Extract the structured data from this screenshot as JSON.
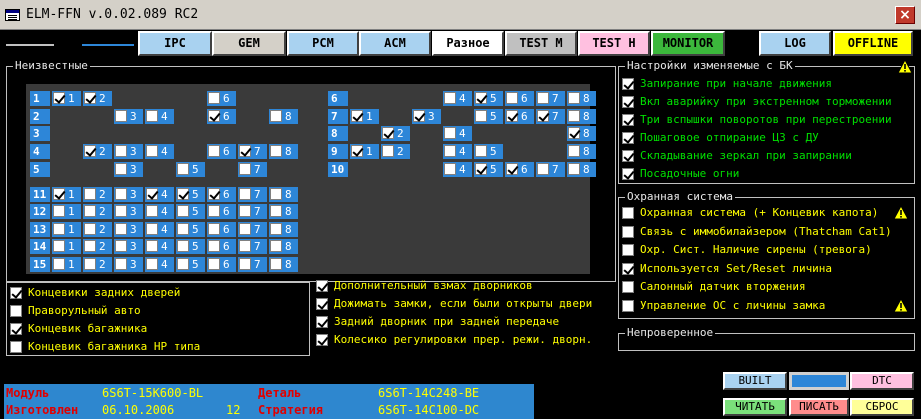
{
  "window": {
    "title": "ELM-FFN    v.0.02.089 RC2",
    "close": "×"
  },
  "status_lamps": {
    "left_color": "#c0c0c0",
    "right_color": "#2d86d8"
  },
  "tabs": [
    {
      "label": "IPC",
      "bg": "#a9d2f0"
    },
    {
      "label": "GEM",
      "bg": "#d4d0c8"
    },
    {
      "label": "PCM",
      "bg": "#a9d2f0"
    },
    {
      "label": "ACM",
      "bg": "#a9d2f0"
    },
    {
      "label": "Разное",
      "bg": "#ffffff"
    },
    {
      "label": "TEST M",
      "bg": "#c0c0c0"
    },
    {
      "label": "TEST H",
      "bg": "#ffc0e0"
    },
    {
      "label": "MONITOR",
      "bg": "#3cb83c"
    },
    {
      "label": "LOG",
      "bg": "#a9d2f0"
    },
    {
      "label": "OFFLINE",
      "bg": "#ffff00"
    }
  ],
  "unknown": {
    "title": "Неизвестные",
    "left_rows": [
      {
        "label": "1",
        "cells": [
          {
            "n": "1",
            "on": true,
            "cb": true
          },
          {
            "n": "2",
            "on": true,
            "cb": true
          },
          {
            "n": "",
            "cb": false
          },
          {
            "n": "",
            "cb": false
          },
          {
            "n": "",
            "cb": false
          },
          {
            "n": "6",
            "on": false,
            "cb": true
          },
          {
            "n": "",
            "cb": false
          },
          {
            "n": "",
            "cb": false
          }
        ]
      },
      {
        "label": "2",
        "cells": [
          {
            "n": "",
            "cb": false
          },
          {
            "n": "",
            "cb": false
          },
          {
            "n": "3",
            "on": false,
            "cb": true
          },
          {
            "n": "4",
            "on": false,
            "cb": true
          },
          {
            "n": "",
            "cb": false
          },
          {
            "n": "6",
            "on": true,
            "cb": true
          },
          {
            "n": "",
            "cb": false
          },
          {
            "n": "8",
            "on": false,
            "cb": true
          }
        ]
      },
      {
        "label": "3",
        "cells": [
          {
            "n": "",
            "cb": false
          },
          {
            "n": "",
            "cb": false
          },
          {
            "n": "",
            "cb": false
          },
          {
            "n": "",
            "cb": false
          },
          {
            "n": "",
            "cb": false
          },
          {
            "n": "",
            "cb": false
          },
          {
            "n": "",
            "cb": false
          },
          {
            "n": "",
            "cb": false
          }
        ]
      },
      {
        "label": "4",
        "cells": [
          {
            "n": "",
            "cb": false
          },
          {
            "n": "2",
            "on": true,
            "cb": true
          },
          {
            "n": "3",
            "on": false,
            "cb": true
          },
          {
            "n": "4",
            "on": false,
            "cb": true
          },
          {
            "n": "",
            "cb": false
          },
          {
            "n": "6",
            "on": false,
            "cb": true
          },
          {
            "n": "7",
            "on": true,
            "cb": true
          },
          {
            "n": "8",
            "on": false,
            "cb": true
          }
        ]
      },
      {
        "label": "5",
        "cells": [
          {
            "n": "",
            "cb": false
          },
          {
            "n": "",
            "cb": false
          },
          {
            "n": "3",
            "on": false,
            "cb": true
          },
          {
            "n": "",
            "cb": false
          },
          {
            "n": "5",
            "on": false,
            "cb": true
          },
          {
            "n": "",
            "cb": false
          },
          {
            "n": "7",
            "on": false,
            "cb": true
          },
          {
            "n": "",
            "cb": false
          }
        ]
      },
      {
        "label": "11",
        "cells": [
          {
            "n": "1",
            "on": true,
            "cb": true
          },
          {
            "n": "2",
            "on": false,
            "cb": true
          },
          {
            "n": "3",
            "on": false,
            "cb": true
          },
          {
            "n": "4",
            "on": true,
            "cb": true
          },
          {
            "n": "5",
            "on": true,
            "cb": true
          },
          {
            "n": "6",
            "on": true,
            "cb": true
          },
          {
            "n": "7",
            "on": false,
            "cb": true
          },
          {
            "n": "8",
            "on": false,
            "cb": true
          }
        ]
      },
      {
        "label": "12",
        "cells": [
          {
            "n": "1",
            "on": false,
            "cb": true
          },
          {
            "n": "2",
            "on": false,
            "cb": true
          },
          {
            "n": "3",
            "on": false,
            "cb": true
          },
          {
            "n": "4",
            "on": false,
            "cb": true
          },
          {
            "n": "5",
            "on": false,
            "cb": true
          },
          {
            "n": "6",
            "on": false,
            "cb": true
          },
          {
            "n": "7",
            "on": false,
            "cb": true
          },
          {
            "n": "8",
            "on": false,
            "cb": true
          }
        ]
      },
      {
        "label": "13",
        "cells": [
          {
            "n": "1",
            "on": false,
            "cb": true
          },
          {
            "n": "2",
            "on": false,
            "cb": true
          },
          {
            "n": "3",
            "on": false,
            "cb": true
          },
          {
            "n": "4",
            "on": false,
            "cb": true
          },
          {
            "n": "5",
            "on": false,
            "cb": true
          },
          {
            "n": "6",
            "on": false,
            "cb": true
          },
          {
            "n": "7",
            "on": false,
            "cb": true
          },
          {
            "n": "8",
            "on": false,
            "cb": true
          }
        ]
      },
      {
        "label": "14",
        "cells": [
          {
            "n": "1",
            "on": false,
            "cb": true
          },
          {
            "n": "2",
            "on": false,
            "cb": true
          },
          {
            "n": "3",
            "on": false,
            "cb": true
          },
          {
            "n": "4",
            "on": false,
            "cb": true
          },
          {
            "n": "5",
            "on": false,
            "cb": true
          },
          {
            "n": "6",
            "on": false,
            "cb": true
          },
          {
            "n": "7",
            "on": false,
            "cb": true
          },
          {
            "n": "8",
            "on": false,
            "cb": true
          }
        ]
      },
      {
        "label": "15",
        "cells": [
          {
            "n": "1",
            "on": false,
            "cb": true
          },
          {
            "n": "2",
            "on": false,
            "cb": true
          },
          {
            "n": "3",
            "on": false,
            "cb": true
          },
          {
            "n": "4",
            "on": false,
            "cb": true
          },
          {
            "n": "5",
            "on": false,
            "cb": true
          },
          {
            "n": "6",
            "on": false,
            "cb": true
          },
          {
            "n": "7",
            "on": false,
            "cb": true
          },
          {
            "n": "8",
            "on": false,
            "cb": true
          }
        ]
      }
    ],
    "right_rows": [
      {
        "label": "6",
        "cells": [
          {
            "n": "",
            "cb": false
          },
          {
            "n": "",
            "cb": false
          },
          {
            "n": "",
            "cb": false
          },
          {
            "n": "4",
            "on": false,
            "cb": true
          },
          {
            "n": "5",
            "on": true,
            "cb": true
          },
          {
            "n": "6",
            "on": false,
            "cb": true
          },
          {
            "n": "7",
            "on": false,
            "cb": true
          },
          {
            "n": "8",
            "on": false,
            "cb": true
          }
        ]
      },
      {
        "label": "7",
        "cells": [
          {
            "n": "1",
            "on": true,
            "cb": true
          },
          {
            "n": "",
            "cb": false
          },
          {
            "n": "3",
            "on": true,
            "cb": true
          },
          {
            "n": "",
            "cb": false
          },
          {
            "n": "5",
            "on": false,
            "cb": true
          },
          {
            "n": "6",
            "on": true,
            "cb": true
          },
          {
            "n": "7",
            "on": true,
            "cb": true
          },
          {
            "n": "8",
            "on": false,
            "cb": true
          }
        ]
      },
      {
        "label": "8",
        "cells": [
          {
            "n": "",
            "cb": false
          },
          {
            "n": "2",
            "on": true,
            "cb": true
          },
          {
            "n": "",
            "cb": false
          },
          {
            "n": "4",
            "on": false,
            "cb": true
          },
          {
            "n": "",
            "cb": false
          },
          {
            "n": "",
            "cb": false
          },
          {
            "n": "",
            "cb": false
          },
          {
            "n": "8",
            "on": true,
            "cb": true
          }
        ]
      },
      {
        "label": "9",
        "cells": [
          {
            "n": "1",
            "on": true,
            "cb": true
          },
          {
            "n": "2",
            "on": false,
            "cb": true
          },
          {
            "n": "",
            "cb": false
          },
          {
            "n": "4",
            "on": false,
            "cb": true
          },
          {
            "n": "5",
            "on": false,
            "cb": true
          },
          {
            "n": "",
            "cb": false
          },
          {
            "n": "",
            "cb": false
          },
          {
            "n": "8",
            "on": false,
            "cb": true
          }
        ]
      },
      {
        "label": "10",
        "cells": [
          {
            "n": "",
            "cb": false
          },
          {
            "n": "",
            "cb": false
          },
          {
            "n": "",
            "cb": false
          },
          {
            "n": "4",
            "on": false,
            "cb": true
          },
          {
            "n": "5",
            "on": true,
            "cb": true
          },
          {
            "n": "6",
            "on": true,
            "cb": true
          },
          {
            "n": "7",
            "on": false,
            "cb": true
          },
          {
            "n": "8",
            "on": false,
            "cb": true
          }
        ]
      }
    ]
  },
  "left_options": [
    {
      "label": "Концевики задних дверей",
      "on": true
    },
    {
      "label": "Праворульный авто",
      "on": false
    },
    {
      "label": "Концевик багажника",
      "on": true
    },
    {
      "label": "Концевик багажника HP типа",
      "on": false
    }
  ],
  "middle_options": [
    {
      "label": "Дополнительный взмах дворников",
      "on": true
    },
    {
      "label": "Дожимать замки, если были открыты двери",
      "on": true
    },
    {
      "label": "Задний дворник при задней передаче",
      "on": true
    },
    {
      "label": "Колесико регулировки прер. режи. дворн.",
      "on": true
    }
  ],
  "bk_settings": {
    "title": "Настройки изменяемые с БК",
    "items": [
      {
        "label": "Запирание при начале движения",
        "on": true
      },
      {
        "label": "Вкл аварийку при экстренном торможении",
        "on": true
      },
      {
        "label": "Три вспышки поворотов при перестроении",
        "on": true
      },
      {
        "label": "Пошаговое отпирание ЦЗ с ДУ",
        "on": true
      },
      {
        "label": "Складывание зеркал при запирании",
        "on": true
      },
      {
        "label": "Посадочные огни",
        "on": true
      }
    ]
  },
  "security": {
    "title": "Охранная система",
    "items": [
      {
        "label": "Охранная система (+ Концевик капота)",
        "on": false,
        "warn": true
      },
      {
        "label": "Связь с иммобилайзером (Thatcham Cat1)",
        "on": false,
        "warn": false
      },
      {
        "label": "Охр. Сист. Наличие сирены (тревога)",
        "on": false,
        "warn": false
      },
      {
        "label": "Используется Set/Reset личина",
        "on": true,
        "warn": false
      },
      {
        "label": "Салонный датчик вторжения",
        "on": false,
        "warn": false
      },
      {
        "label": "Управление ОС с личины замка",
        "on": false,
        "warn": true
      }
    ]
  },
  "unverified": {
    "title": "Непроверенное"
  },
  "info": {
    "module_label": "Модуль",
    "module_value": "6S6T-15K600-BL",
    "part_label": "Деталь",
    "part_value": "6S6T-14C248-BE",
    "made_label": "Изготовлен",
    "made_value": "06.10.2006",
    "made_extra": "12",
    "strategy_label": "Стратегия",
    "strategy_value": "6S6T-14C100-DC"
  },
  "bottom_buttons": {
    "built": "BUILT",
    "dtc": "DTC",
    "read": "ЧИТАТЬ",
    "write": "ПИСАТЬ",
    "reset": "СБРОС"
  }
}
